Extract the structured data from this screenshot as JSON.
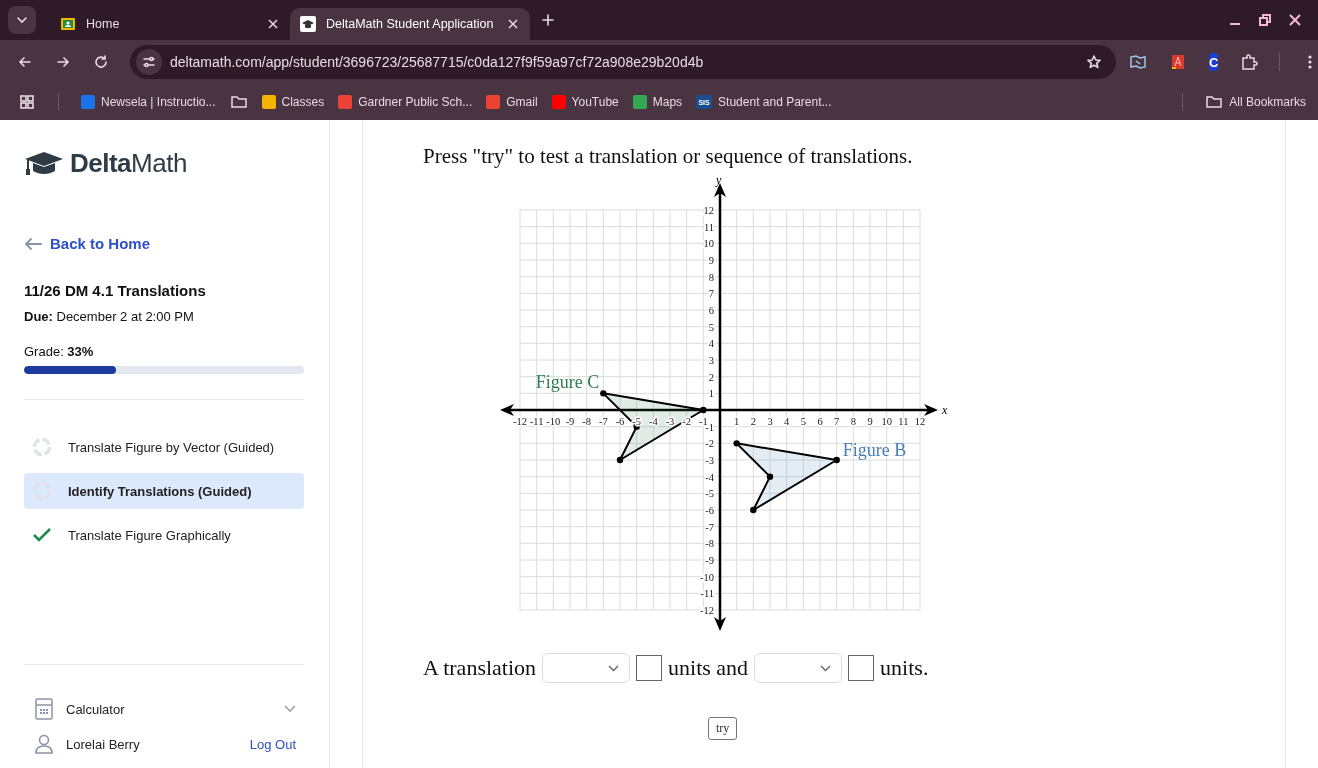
{
  "browser": {
    "tabs": [
      {
        "title": "Home",
        "kind": "classroom",
        "selected": false
      },
      {
        "title": "DeltaMath Student Application",
        "kind": "deltamath",
        "selected": true
      }
    ],
    "url": "deltamath.com/app/student/3696723/25687715/c0da127f9f59a97cf72a908e29b20d4b",
    "bookmarks": [
      {
        "kind": "site",
        "label": "Newsela | Instructio...",
        "color": "#1a73e8"
      },
      {
        "kind": "folder"
      },
      {
        "kind": "site",
        "label": "Classes",
        "color": "#f4b400"
      },
      {
        "kind": "site",
        "label": "Gardner Public Sch...",
        "color": "#ea4335"
      },
      {
        "kind": "site",
        "label": "Gmail",
        "color": "#ea4335"
      },
      {
        "kind": "site",
        "label": "YouTube",
        "color": "#ff0000"
      },
      {
        "kind": "site",
        "label": "Maps",
        "color": "#34a853"
      },
      {
        "kind": "site",
        "label": "Student and Parent...",
        "color": "#1b4f8c",
        "badge": "SIS"
      }
    ],
    "all_bookmarks": "All Bookmarks",
    "extension_badge": "C"
  },
  "sidebar": {
    "logo": "**Delta**Math",
    "back_link": "Back to Home",
    "assignment_title": "11/26 DM 4.1 Translations",
    "due": "**Due:** December 2 at 2:00 PM",
    "grade": "Grade: **33%**",
    "grade_progress": {
      "level": 0.33
    },
    "skills": [
      {
        "label": "Translate Figure by Vector (Guided)",
        "kind": "in_progress",
        "selected": false
      },
      {
        "label": "Identify Translations (Guided)",
        "kind": "in_progress",
        "selected": true
      },
      {
        "label": "Translate Figure Graphically",
        "kind": "complete",
        "selected": false
      }
    ],
    "calculator": "Calculator",
    "user_name": "Lorelai Berry",
    "logout": "Log Out"
  },
  "problem": {
    "prompt": "Press \"try\" to test a translation or sequence of translations.",
    "chart_data": {
      "type": "area",
      "grid": true,
      "xlabel": "x",
      "ylabel": "y",
      "xlim": [
        -12,
        12
      ],
      "ylim": [
        -12,
        12
      ],
      "xticks": [
        -12,
        -11,
        -10,
        -9,
        -8,
        -7,
        -6,
        -5,
        -4,
        -3,
        -2,
        -1,
        1,
        2,
        3,
        4,
        5,
        6,
        7,
        8,
        9,
        10,
        11,
        12
      ],
      "yticks": [
        12,
        11,
        10,
        9,
        8,
        7,
        6,
        5,
        4,
        3,
        2,
        1,
        -1,
        -2,
        -3,
        -4,
        -5,
        -6,
        -7,
        -8,
        -9,
        -10,
        -11,
        -12
      ],
      "series": [
        {
          "name": "Figure C",
          "color": "#2e7d4f",
          "x": [
            -7,
            -1,
            -6,
            -5,
            -7
          ],
          "values": [
            1,
            0,
            -3,
            -1,
            1
          ]
        },
        {
          "name": "Figure B",
          "color": "#4a7fb5",
          "x": [
            1,
            7,
            2,
            3,
            1
          ],
          "values": [
            -2,
            -3,
            -6,
            -4,
            -2
          ]
        }
      ]
    },
    "answer_parts": [
      "A translation",
      "units and",
      "units."
    ],
    "try_button": "try"
  }
}
